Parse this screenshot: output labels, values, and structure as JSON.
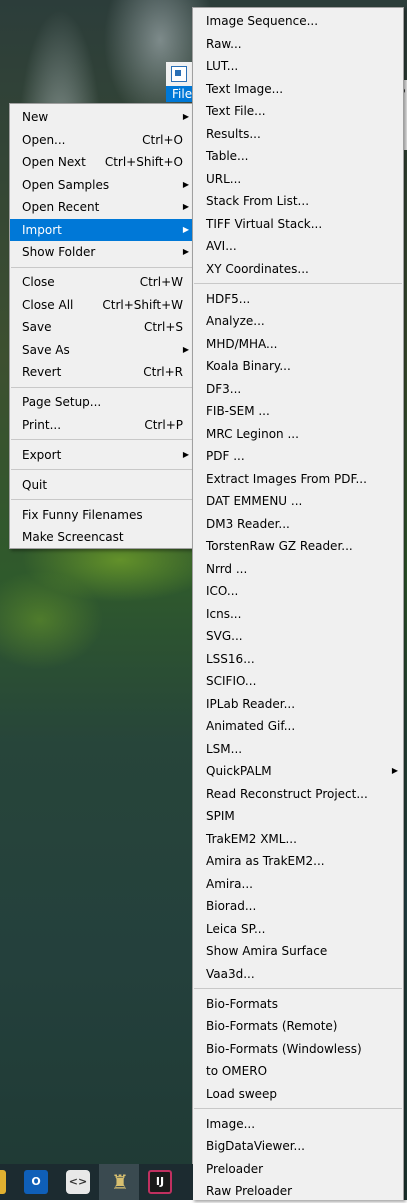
{
  "app": {
    "file_tab_label": "File",
    "right_strip_label": "P"
  },
  "file_menu": {
    "items": [
      {
        "label": "New",
        "shortcut": "",
        "submenu": true
      },
      {
        "label": "Open...",
        "shortcut": "Ctrl+O",
        "submenu": false
      },
      {
        "label": "Open Next",
        "shortcut": "Ctrl+Shift+O",
        "submenu": false
      },
      {
        "label": "Open Samples",
        "shortcut": "",
        "submenu": true
      },
      {
        "label": "Open Recent",
        "shortcut": "",
        "submenu": true
      },
      {
        "label": "Import",
        "shortcut": "",
        "submenu": true,
        "active": true
      },
      {
        "label": "Show Folder",
        "shortcut": "",
        "submenu": true
      },
      {
        "separator": true
      },
      {
        "label": "Close",
        "shortcut": "Ctrl+W",
        "submenu": false
      },
      {
        "label": "Close All",
        "shortcut": "Ctrl+Shift+W",
        "submenu": false
      },
      {
        "label": "Save",
        "shortcut": "Ctrl+S",
        "submenu": false
      },
      {
        "label": "Save As",
        "shortcut": "",
        "submenu": true
      },
      {
        "label": "Revert",
        "shortcut": "Ctrl+R",
        "submenu": false
      },
      {
        "separator": true
      },
      {
        "label": "Page Setup...",
        "shortcut": "",
        "submenu": false
      },
      {
        "label": "Print...",
        "shortcut": "Ctrl+P",
        "submenu": false
      },
      {
        "separator": true
      },
      {
        "label": "Export",
        "shortcut": "",
        "submenu": true
      },
      {
        "separator": true
      },
      {
        "label": "Quit",
        "shortcut": "",
        "submenu": false
      },
      {
        "separator": true
      },
      {
        "label": "Fix Funny Filenames",
        "shortcut": "",
        "submenu": false
      },
      {
        "label": "Make Screencast",
        "shortcut": "",
        "submenu": false
      }
    ]
  },
  "import_menu": {
    "items": [
      {
        "label": "Image Sequence..."
      },
      {
        "label": "Raw..."
      },
      {
        "label": "LUT..."
      },
      {
        "label": "Text Image..."
      },
      {
        "label": "Text File..."
      },
      {
        "label": "Results..."
      },
      {
        "label": "Table..."
      },
      {
        "label": "URL..."
      },
      {
        "label": "Stack From List..."
      },
      {
        "label": "TIFF Virtual Stack..."
      },
      {
        "label": "AVI..."
      },
      {
        "label": "XY Coordinates..."
      },
      {
        "separator": true
      },
      {
        "label": "HDF5..."
      },
      {
        "label": "Analyze..."
      },
      {
        "label": "MHD/MHA..."
      },
      {
        "label": "Koala Binary..."
      },
      {
        "label": "DF3..."
      },
      {
        "label": "FIB-SEM ..."
      },
      {
        "label": "MRC Leginon ..."
      },
      {
        "label": "PDF ..."
      },
      {
        "label": "Extract Images From PDF..."
      },
      {
        "label": "DAT EMMENU ..."
      },
      {
        "label": "DM3 Reader..."
      },
      {
        "label": "TorstenRaw GZ Reader..."
      },
      {
        "label": "Nrrd ..."
      },
      {
        "label": "ICO..."
      },
      {
        "label": "Icns..."
      },
      {
        "label": "SVG..."
      },
      {
        "label": "LSS16..."
      },
      {
        "label": "SCIFIO..."
      },
      {
        "label": "IPLab Reader..."
      },
      {
        "label": "Animated Gif..."
      },
      {
        "label": "LSM..."
      },
      {
        "label": "QuickPALM",
        "submenu": true
      },
      {
        "label": "Read Reconstruct Project..."
      },
      {
        "label": "SPIM"
      },
      {
        "label": "TrakEM2 XML..."
      },
      {
        "label": "Amira as TrakEM2..."
      },
      {
        "label": "Amira..."
      },
      {
        "label": "Biorad..."
      },
      {
        "label": "Leica SP..."
      },
      {
        "label": "Show Amira Surface"
      },
      {
        "label": "Vaa3d..."
      },
      {
        "separator": true
      },
      {
        "label": "Bio-Formats"
      },
      {
        "label": "Bio-Formats (Remote)"
      },
      {
        "label": "Bio-Formats (Windowless)"
      },
      {
        "label": "to OMERO"
      },
      {
        "label": "Load sweep"
      },
      {
        "separator": true
      },
      {
        "label": "Image..."
      },
      {
        "label": "BigDataViewer..."
      },
      {
        "label": "Preloader"
      },
      {
        "label": "Raw Preloader"
      }
    ]
  },
  "taskbar": {
    "icons": [
      "outlook-icon",
      "code-editor-icon",
      "fiji-icon",
      "intellij-icon"
    ],
    "outlook_glyph": "O",
    "code_glyph": "<>",
    "fiji_glyph": "♜",
    "ij_glyph": "IJ"
  },
  "colors": {
    "menu_bg": "#f0f0f0",
    "highlight": "#0078d7",
    "separator": "#c8c8c8"
  }
}
